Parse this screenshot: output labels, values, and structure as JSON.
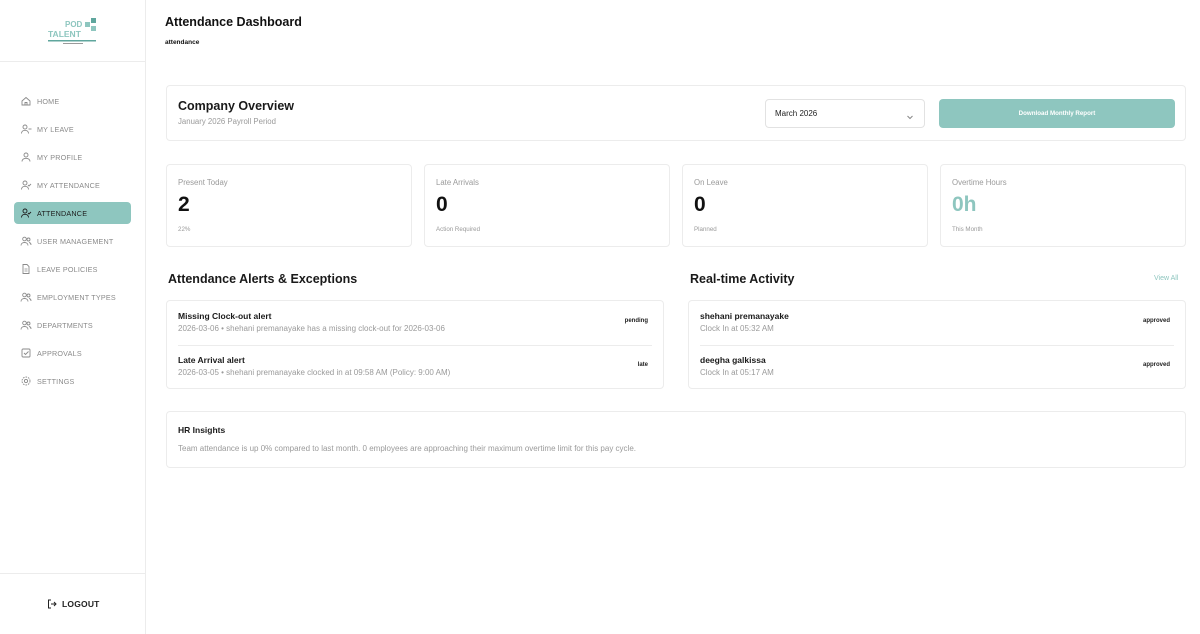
{
  "brand": {
    "name_line1": "POD",
    "name_line2": "TALENT",
    "tagline": "PEOPLE. PROCESS. CONNECTED.",
    "accent_color": "#8ec6bf"
  },
  "sidebar": {
    "items": [
      {
        "label": "HOME",
        "icon": "home-icon",
        "active": false
      },
      {
        "label": "MY LEAVE",
        "icon": "user-minus-icon",
        "active": false
      },
      {
        "label": "MY PROFILE",
        "icon": "user-icon",
        "active": false
      },
      {
        "label": "MY ATTENDANCE",
        "icon": "user-check-icon",
        "active": false
      },
      {
        "label": "ATTENDANCE",
        "icon": "user-check-icon",
        "active": true
      },
      {
        "label": "USER MANAGEMENT",
        "icon": "users-icon",
        "active": false
      },
      {
        "label": "LEAVE POLICIES",
        "icon": "document-icon",
        "active": false
      },
      {
        "label": "EMPLOYMENT TYPES",
        "icon": "users-icon",
        "active": false
      },
      {
        "label": "DEPARTMENTS",
        "icon": "users-icon",
        "active": false
      },
      {
        "label": "APPROVALS",
        "icon": "check-square-icon",
        "active": false
      },
      {
        "label": "SETTINGS",
        "icon": "gear-icon",
        "active": false
      }
    ],
    "logout_label": "LOGOUT"
  },
  "header": {
    "title": "Attendance Dashboard",
    "subtitle": "attendance"
  },
  "overview": {
    "title": "Company Overview",
    "subtitle": "January 2026 Payroll Period",
    "month_select": "March 2026",
    "download_label": "Download Monthly Report"
  },
  "stats": [
    {
      "label": "Present Today",
      "value": "2",
      "foot": "22%"
    },
    {
      "label": "Late Arrivals",
      "value": "0",
      "foot": "Action Required"
    },
    {
      "label": "On Leave",
      "value": "0",
      "foot": "Planned"
    },
    {
      "label": "Overtime Hours",
      "value": "0h",
      "foot": "This Month"
    }
  ],
  "alerts": {
    "title": "Attendance Alerts & Exceptions",
    "items": [
      {
        "title": "Missing Clock-out alert",
        "desc": "2026-03-06 • shehani premanayake has a missing clock-out for 2026-03-06",
        "badge": "pending"
      },
      {
        "title": "Late Arrival alert",
        "desc": "2026-03-05 • shehani premanayake clocked in at 09:58 AM (Policy: 9:00 AM)",
        "badge": "late"
      }
    ]
  },
  "activity": {
    "title": "Real-time Activity",
    "view_all": "View All",
    "items": [
      {
        "title": "shehani premanayake",
        "desc": "Clock In at 05:32 AM",
        "badge": "approved"
      },
      {
        "title": "deegha galkissa",
        "desc": "Clock In at 05:17 AM",
        "badge": "approved"
      }
    ]
  },
  "insights": {
    "title": "HR Insights",
    "text": "Team attendance is up 0% compared to last month. 0 employees are approaching their maximum overtime limit for this pay cycle."
  }
}
